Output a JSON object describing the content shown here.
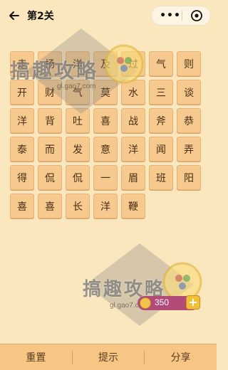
{
  "header": {
    "title": "第2关",
    "capsule_more": "•••"
  },
  "grid": {
    "tiles": [
      "走",
      "扬",
      "洋",
      "及",
      "过",
      "气",
      "则",
      "开",
      "财",
      "气",
      "莫",
      "水",
      "三",
      "谈",
      "洋",
      "背",
      "吐",
      "喜",
      "战",
      "斧",
      "恭",
      "泰",
      "而",
      "发",
      "意",
      "洋",
      "闻",
      "弄",
      "得",
      "侃",
      "侃",
      "一",
      "眉",
      "班",
      "阳",
      "喜",
      "喜",
      "长",
      "洋",
      "鞭"
    ]
  },
  "coins": {
    "value": "350",
    "add": "+"
  },
  "watermark": {
    "text": "搞趣攻略",
    "url_1": "gl.gao7.com",
    "url_2": "gl.gao7.com"
  },
  "bottom_bar": {
    "reset": "重置",
    "hint": "提示",
    "share": "分享"
  }
}
